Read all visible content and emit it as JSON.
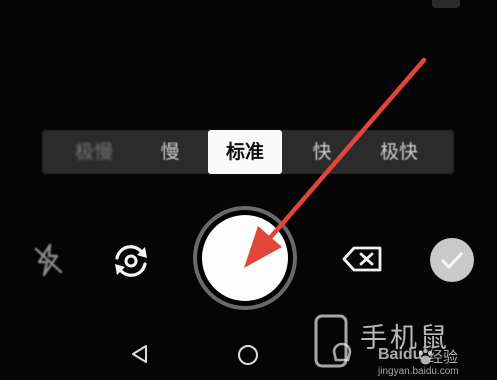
{
  "speed_selector": {
    "options": [
      "极慢",
      "慢",
      "标准",
      "快",
      "极快"
    ],
    "selected": "标准"
  },
  "controls": {
    "flash": {
      "icon": "flash-off-icon"
    },
    "switch_camera": {
      "icon": "switch-camera-icon"
    },
    "shutter": {
      "icon": "shutter-button"
    },
    "delete": {
      "icon": "backspace-icon"
    },
    "confirm": {
      "icon": "check-icon"
    }
  },
  "nav_bar": {
    "buttons": [
      "back-icon",
      "home-icon"
    ]
  },
  "annotation": {
    "arrow_color": "#e2453a"
  },
  "watermark": {
    "brand": "手机鼠",
    "baidu": "Baidu",
    "baidu_sub": "经验",
    "url": "jingyan.baidu.com"
  },
  "colors": {
    "background": "#050505",
    "selector_bg": "#2b2b2b",
    "selected_bg": "#fafafa",
    "shutter": "#fdfdfd"
  }
}
